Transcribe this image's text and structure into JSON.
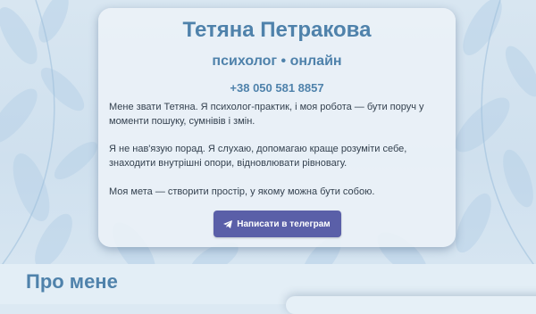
{
  "profile": {
    "name": "Тетяна Петракова",
    "subtitle": "психолог • онлайн",
    "phone": "+38 050 581 8857"
  },
  "intro": {
    "paragraph1": "Мене звати Тетяна. Я психолог-практик, і моя робота — бути поруч у моменти пошуку, сумнівів і змін.",
    "paragraph2": "Я не нав'язую порад. Я слухаю, допомагаю краще розуміти себе, знаходити внутрішні опори, відновлювати рівновагу.",
    "paragraph3": "Моя мета — створити простір, у якому можна бути собою."
  },
  "cta": {
    "label": "Написати в телеграм",
    "icon": "telegram-icon",
    "color": "#5a5fa8"
  },
  "about": {
    "heading": "Про мене"
  },
  "colors": {
    "accent": "#4f82ab",
    "background": "#d8e6f1"
  }
}
